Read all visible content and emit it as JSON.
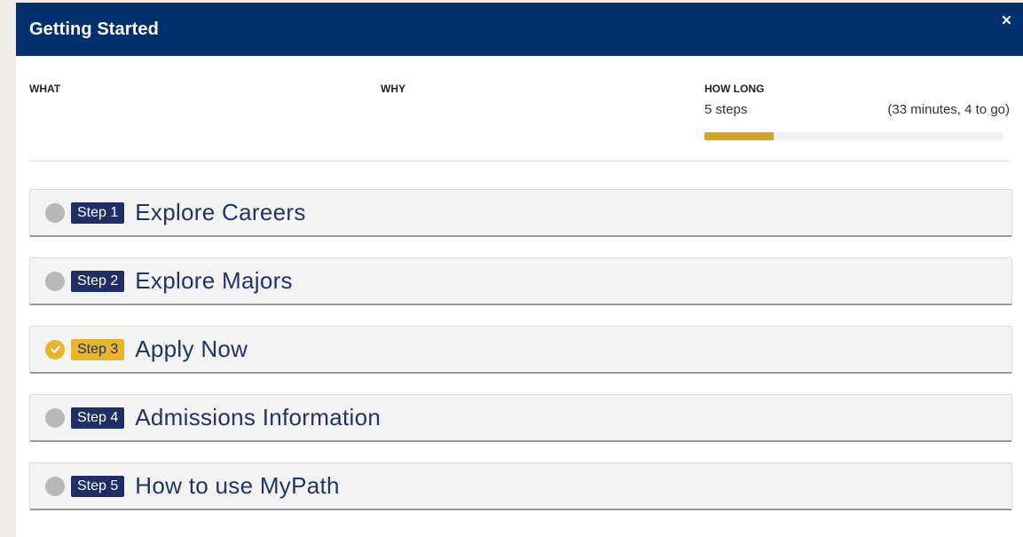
{
  "dialog": {
    "title": "Getting Started",
    "close_label": "×"
  },
  "info": {
    "what_label": "WHAT",
    "why_label": "WHY",
    "how_long_label": "HOW LONG",
    "steps_count": "5 steps",
    "remaining": "(33 minutes, 4 to go)",
    "progress_fraction": 0.23,
    "progress_color": "#d4a51c"
  },
  "colors": {
    "header_bg": "#00306e",
    "badge_bg": "#1f2f66",
    "done_color": "#e6b528",
    "pending_dot": "#b8b8b8"
  },
  "steps": [
    {
      "badge": "Step 1",
      "title": "Explore Careers",
      "completed": false,
      "icon": "circle-pending-icon"
    },
    {
      "badge": "Step 2",
      "title": "Explore Majors",
      "completed": false,
      "icon": "circle-pending-icon"
    },
    {
      "badge": "Step 3",
      "title": "Apply Now",
      "completed": true,
      "icon": "check-circle-icon"
    },
    {
      "badge": "Step 4",
      "title": "Admissions Information",
      "completed": false,
      "icon": "circle-pending-icon"
    },
    {
      "badge": "Step 5",
      "title": "How to use MyPath",
      "completed": false,
      "icon": "circle-pending-icon"
    }
  ]
}
